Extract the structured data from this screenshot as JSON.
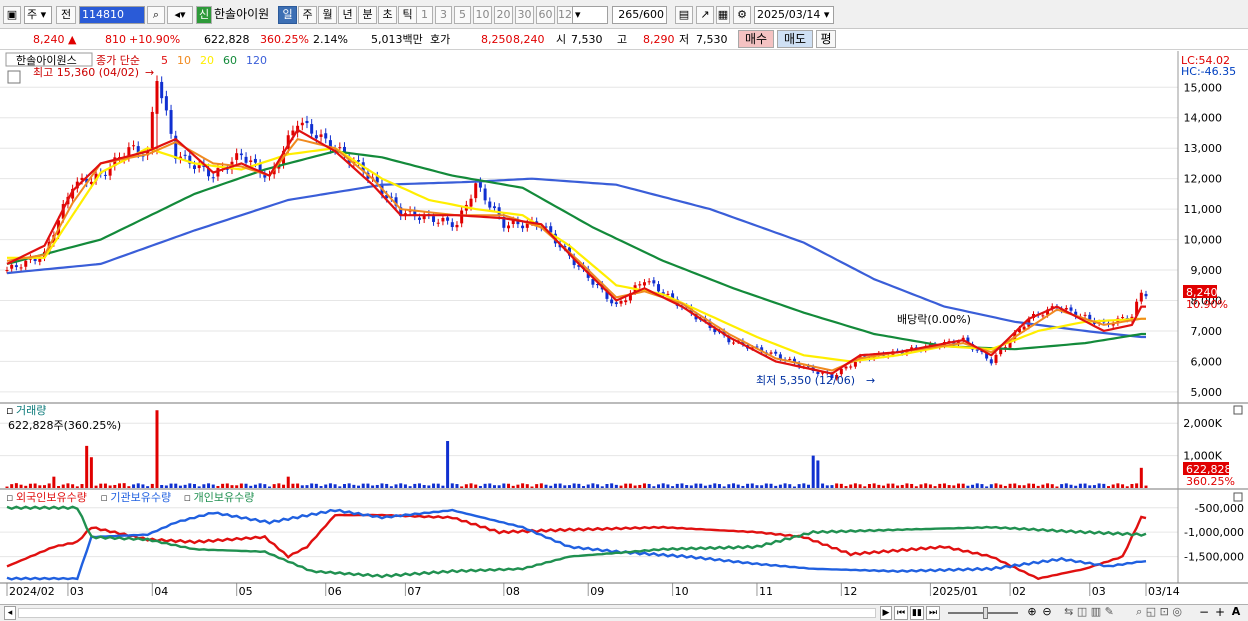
{
  "toolbar": {
    "type_select": "주",
    "prev_label": "전",
    "code": "114810",
    "name_badge": "신",
    "name": "한솔아이원",
    "periods": [
      "일",
      "주",
      "월",
      "년",
      "분",
      "초",
      "틱"
    ],
    "active_period": "일",
    "minutes": [
      "1",
      "3",
      "5",
      "10",
      "20",
      "30",
      "60",
      "120"
    ],
    "count": "265",
    "count_max": "/600",
    "date": "2025/03/14"
  },
  "quote": {
    "price": "8,240",
    "change": "810",
    "change_pct": "+10.90%",
    "volume": "622,828",
    "volume_ratio": "360.25%",
    "turnover": "2.14%",
    "amount": "5,013백만",
    "ask_label": "호가",
    "ask": "8,250",
    "bid": "8,240",
    "open_label": "시",
    "open": "7,530",
    "high_label": "고",
    "high": "8,290",
    "low_label": "저",
    "low": "7,530",
    "buy_label": "매수",
    "sell_label": "매도",
    "avg_label": "평",
    "up_color": "#e00000",
    "down_color": "#0040c0"
  },
  "chart_data": [
    {
      "type": "candlestick",
      "title": "한솔아이원스",
      "legend": {
        "label": "종가 단순",
        "periods": [
          "5",
          "10",
          "20",
          "60",
          "120"
        ],
        "colors": [
          "#e01010",
          "#f08a20",
          "#ffee00",
          "#138a3a",
          "#3a5ed8"
        ]
      },
      "corner_labels": [
        "LC:54.02",
        "HC:-46.35"
      ],
      "annotations": {
        "high_label": "최고 15,360 (04/02)",
        "low_label": "최저 5,350 (12/06)",
        "dividend_label": "배당락(0.00%)"
      },
      "price_tag": "8,240",
      "pct_tag": "10.90%",
      "y_ticks": [
        "15,000",
        "14,000",
        "13,000",
        "12,000",
        "11,000",
        "10,000",
        "9,000",
        "8,000",
        "7,000",
        "6,000",
        "5,000"
      ],
      "ylim": [
        4700,
        15600
      ],
      "close_path": [
        [
          0,
          9000
        ],
        [
          8,
          9500
        ],
        [
          14,
          11800
        ],
        [
          20,
          12100
        ],
        [
          26,
          13000
        ],
        [
          30,
          12800
        ],
        [
          32,
          15360
        ],
        [
          36,
          12800
        ],
        [
          44,
          12100
        ],
        [
          50,
          12800
        ],
        [
          56,
          12000
        ],
        [
          62,
          13900
        ],
        [
          70,
          13000
        ],
        [
          76,
          12300
        ],
        [
          84,
          10900
        ],
        [
          96,
          10500
        ],
        [
          100,
          11800
        ],
        [
          106,
          10500
        ],
        [
          114,
          10500
        ],
        [
          122,
          9100
        ],
        [
          130,
          7800
        ],
        [
          136,
          8700
        ],
        [
          144,
          7800
        ],
        [
          154,
          6700
        ],
        [
          164,
          6200
        ],
        [
          172,
          5700
        ],
        [
          176,
          5500
        ],
        [
          182,
          6100
        ],
        [
          190,
          6300
        ],
        [
          204,
          6700
        ],
        [
          210,
          6000
        ],
        [
          218,
          7400
        ],
        [
          224,
          7800
        ],
        [
          234,
          7200
        ],
        [
          240,
          7500
        ],
        [
          242,
          8240
        ]
      ],
      "ma5_path": [
        [
          0,
          9200
        ],
        [
          8,
          9800
        ],
        [
          14,
          11600
        ],
        [
          20,
          12500
        ],
        [
          30,
          12900
        ],
        [
          36,
          13300
        ],
        [
          44,
          12200
        ],
        [
          50,
          12500
        ],
        [
          56,
          12100
        ],
        [
          62,
          13600
        ],
        [
          70,
          12900
        ],
        [
          78,
          11800
        ],
        [
          84,
          10800
        ],
        [
          96,
          10800
        ],
        [
          106,
          10700
        ],
        [
          114,
          10500
        ],
        [
          122,
          9200
        ],
        [
          130,
          8000
        ],
        [
          136,
          8400
        ],
        [
          144,
          7800
        ],
        [
          154,
          6800
        ],
        [
          164,
          6000
        ],
        [
          176,
          5600
        ],
        [
          182,
          6200
        ],
        [
          190,
          6300
        ],
        [
          204,
          6700
        ],
        [
          210,
          6200
        ],
        [
          218,
          7400
        ],
        [
          224,
          7800
        ],
        [
          234,
          7000
        ],
        [
          240,
          7200
        ],
        [
          242,
          7800
        ]
      ],
      "ma10_path": [
        [
          0,
          9300
        ],
        [
          8,
          9500
        ],
        [
          14,
          11200
        ],
        [
          20,
          12500
        ],
        [
          30,
          12800
        ],
        [
          36,
          13200
        ],
        [
          44,
          12500
        ],
        [
          50,
          12400
        ],
        [
          56,
          12100
        ],
        [
          62,
          13300
        ],
        [
          70,
          13000
        ],
        [
          78,
          12000
        ],
        [
          84,
          11000
        ],
        [
          96,
          10800
        ],
        [
          106,
          10800
        ],
        [
          114,
          10400
        ],
        [
          122,
          9300
        ],
        [
          130,
          8100
        ],
        [
          136,
          8300
        ],
        [
          144,
          7900
        ],
        [
          154,
          6900
        ],
        [
          164,
          6100
        ],
        [
          176,
          5700
        ],
        [
          182,
          6100
        ],
        [
          190,
          6300
        ],
        [
          204,
          6600
        ],
        [
          210,
          6300
        ],
        [
          218,
          7100
        ],
        [
          224,
          7700
        ],
        [
          234,
          7200
        ],
        [
          242,
          7400
        ]
      ],
      "ma20_path": [
        [
          0,
          9400
        ],
        [
          8,
          9400
        ],
        [
          20,
          12200
        ],
        [
          30,
          13000
        ],
        [
          40,
          12500
        ],
        [
          50,
          12300
        ],
        [
          60,
          12800
        ],
        [
          70,
          13000
        ],
        [
          80,
          12000
        ],
        [
          90,
          11300
        ],
        [
          100,
          11000
        ],
        [
          110,
          10800
        ],
        [
          120,
          9800
        ],
        [
          130,
          8500
        ],
        [
          140,
          8200
        ],
        [
          150,
          7500
        ],
        [
          160,
          6800
        ],
        [
          170,
          6200
        ],
        [
          180,
          6000
        ],
        [
          190,
          6200
        ],
        [
          200,
          6500
        ],
        [
          210,
          6400
        ],
        [
          220,
          7000
        ],
        [
          230,
          7300
        ],
        [
          242,
          7400
        ]
      ],
      "ma60_path": [
        [
          0,
          9200
        ],
        [
          20,
          10000
        ],
        [
          40,
          11500
        ],
        [
          55,
          12300
        ],
        [
          70,
          12900
        ],
        [
          80,
          12700
        ],
        [
          95,
          12100
        ],
        [
          110,
          11700
        ],
        [
          125,
          10400
        ],
        [
          140,
          9300
        ],
        [
          155,
          8400
        ],
        [
          170,
          7600
        ],
        [
          185,
          6900
        ],
        [
          200,
          6500
        ],
        [
          215,
          6400
        ],
        [
          230,
          6600
        ],
        [
          242,
          6900
        ]
      ],
      "ma120_path": [
        [
          0,
          8900
        ],
        [
          20,
          9200
        ],
        [
          40,
          10300
        ],
        [
          60,
          11300
        ],
        [
          80,
          11800
        ],
        [
          100,
          11900
        ],
        [
          112,
          12000
        ],
        [
          130,
          11800
        ],
        [
          150,
          11000
        ],
        [
          170,
          9900
        ],
        [
          185,
          8700
        ],
        [
          200,
          7800
        ],
        [
          215,
          7300
        ],
        [
          230,
          7000
        ],
        [
          242,
          6800
        ]
      ]
    },
    {
      "type": "bar",
      "title": "거래량",
      "readout": "622,828주(360.25%)",
      "y_ticks": [
        "2,000K",
        "1,000K"
      ],
      "ylim": [
        0,
        2500000
      ],
      "tags": [
        "622,828",
        "360.25%"
      ],
      "spikes": [
        [
          2,
          150000
        ],
        [
          10,
          350000
        ],
        [
          17,
          1300000
        ],
        [
          18,
          950000
        ],
        [
          25,
          150000
        ],
        [
          32,
          2400000
        ],
        [
          60,
          350000
        ],
        [
          94,
          1450000
        ],
        [
          172,
          1000000
        ],
        [
          173,
          850000
        ],
        [
          242,
          622828
        ]
      ],
      "baseline": 90000
    },
    {
      "type": "line",
      "legend": [
        "외국인보유수량",
        "기관보유수량",
        "개인보유수량"
      ],
      "colors": [
        "#e01010",
        "#2060e0",
        "#209050"
      ],
      "y_ticks": [
        "-500,000",
        "-1,000,000",
        "-1,500,000"
      ],
      "ylim": [
        -2000000,
        -300000
      ],
      "series": [
        {
          "name": "외국인보유수량",
          "path": [
            [
              0,
              -1700000
            ],
            [
              10,
              -1300000
            ],
            [
              15,
              -1200000
            ],
            [
              18,
              -900000
            ],
            [
              30,
              -1150000
            ],
            [
              40,
              -1200000
            ],
            [
              55,
              -1100000
            ],
            [
              60,
              -1500000
            ],
            [
              64,
              -1300000
            ],
            [
              70,
              -650000
            ],
            [
              80,
              -650000
            ],
            [
              95,
              -700000
            ],
            [
              105,
              -1000000
            ],
            [
              120,
              -950000
            ],
            [
              140,
              -900000
            ],
            [
              160,
              -1000000
            ],
            [
              170,
              -1100000
            ],
            [
              180,
              -1450000
            ],
            [
              200,
              -1300000
            ],
            [
              210,
              -1500000
            ],
            [
              220,
              -1950000
            ],
            [
              230,
              -1750000
            ],
            [
              238,
              -1500000
            ],
            [
              242,
              -700000
            ]
          ]
        },
        {
          "name": "기관보유수량",
          "path": [
            [
              0,
              -1950000
            ],
            [
              15,
              -1950000
            ],
            [
              18,
              -1100000
            ],
            [
              30,
              -1050000
            ],
            [
              36,
              -800000
            ],
            [
              44,
              -600000
            ],
            [
              56,
              -800000
            ],
            [
              70,
              -550000
            ],
            [
              80,
              -700000
            ],
            [
              95,
              -550000
            ],
            [
              110,
              -900000
            ],
            [
              120,
              -1300000
            ],
            [
              130,
              -1400000
            ],
            [
              145,
              -1500000
            ],
            [
              160,
              -1650000
            ],
            [
              172,
              -1750000
            ],
            [
              190,
              -1800000
            ],
            [
              210,
              -1750000
            ],
            [
              225,
              -1550000
            ],
            [
              235,
              -1700000
            ],
            [
              242,
              -1600000
            ]
          ]
        },
        {
          "name": "개인보유수량",
          "path": [
            [
              0,
              -500000
            ],
            [
              15,
              -500000
            ],
            [
              18,
              -1100000
            ],
            [
              30,
              -1150000
            ],
            [
              40,
              -1350000
            ],
            [
              55,
              -1400000
            ],
            [
              65,
              -1800000
            ],
            [
              80,
              -1900000
            ],
            [
              95,
              -1800000
            ],
            [
              110,
              -1750000
            ],
            [
              120,
              -1500000
            ],
            [
              140,
              -1350000
            ],
            [
              160,
              -1300000
            ],
            [
              172,
              -1000000
            ],
            [
              190,
              -950000
            ],
            [
              210,
              -900000
            ],
            [
              230,
              -1000000
            ],
            [
              242,
              -1050000
            ]
          ]
        }
      ]
    }
  ],
  "x_axis": {
    "labels": [
      "2024/02",
      "03",
      "04",
      "05",
      "06",
      "07",
      "08",
      "09",
      "10",
      "11",
      "12",
      "2025/01",
      "02",
      "03",
      "03/14"
    ],
    "index": [
      0,
      13,
      31,
      49,
      68,
      85,
      106,
      124,
      142,
      160,
      178,
      197,
      214,
      231,
      243
    ]
  },
  "bottom_bar": {
    "buttons": [
      "▶",
      "⏮",
      "▶",
      "⏭"
    ]
  }
}
